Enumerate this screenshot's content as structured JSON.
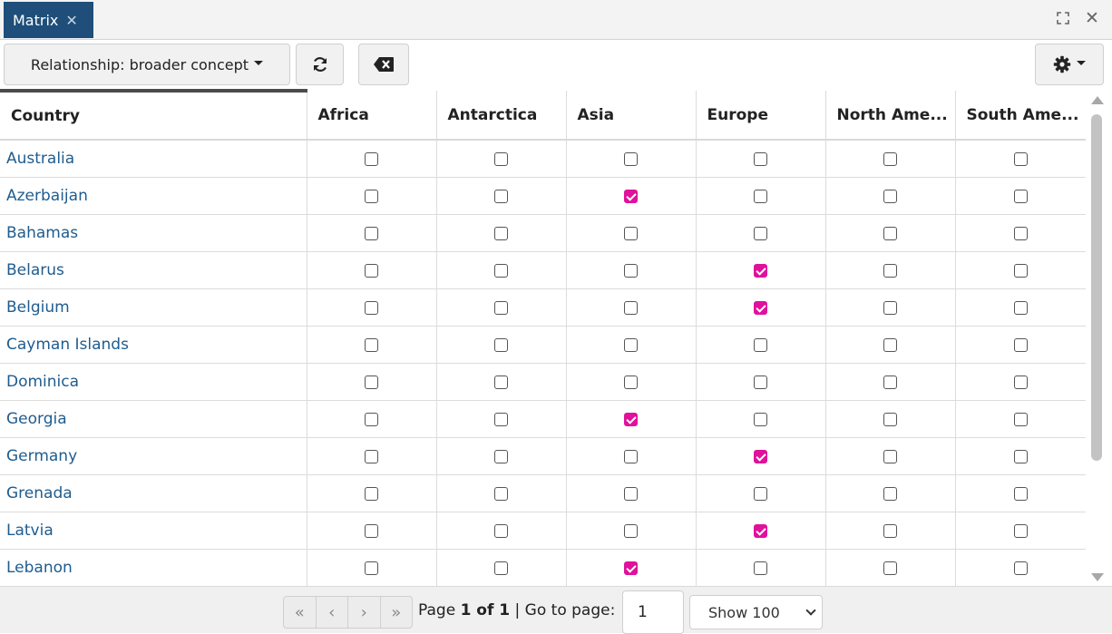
{
  "tab": {
    "title": "Matrix",
    "close_glyph": "✕"
  },
  "window": {
    "expand_icon": "⛶",
    "close_icon": "✕"
  },
  "toolbar": {
    "relationship_label": "Relationship: broader concept",
    "refresh_icon": "↻",
    "clear_icon": "⌫",
    "settings_icon": "⚙"
  },
  "grid": {
    "columns": [
      "Country",
      "Africa",
      "Antarctica",
      "Asia",
      "Europe",
      "North Ame...",
      "South Ame..."
    ],
    "rows": [
      {
        "name": "Australia",
        "checks": [
          false,
          false,
          false,
          false,
          false,
          false
        ]
      },
      {
        "name": "Azerbaijan",
        "checks": [
          false,
          false,
          true,
          false,
          false,
          false
        ]
      },
      {
        "name": "Bahamas",
        "checks": [
          false,
          false,
          false,
          false,
          false,
          false
        ]
      },
      {
        "name": "Belarus",
        "checks": [
          false,
          false,
          false,
          true,
          false,
          false
        ]
      },
      {
        "name": "Belgium",
        "checks": [
          false,
          false,
          false,
          true,
          false,
          false
        ]
      },
      {
        "name": "Cayman Islands",
        "checks": [
          false,
          false,
          false,
          false,
          false,
          false
        ]
      },
      {
        "name": "Dominica",
        "checks": [
          false,
          false,
          false,
          false,
          false,
          false
        ]
      },
      {
        "name": "Georgia",
        "checks": [
          false,
          false,
          true,
          false,
          false,
          false
        ]
      },
      {
        "name": "Germany",
        "checks": [
          false,
          false,
          false,
          true,
          false,
          false
        ]
      },
      {
        "name": "Grenada",
        "checks": [
          false,
          false,
          false,
          false,
          false,
          false
        ]
      },
      {
        "name": "Latvia",
        "checks": [
          false,
          false,
          false,
          true,
          false,
          false
        ]
      },
      {
        "name": "Lebanon",
        "checks": [
          false,
          false,
          true,
          false,
          false,
          false
        ]
      }
    ]
  },
  "footer": {
    "first_icon": "«",
    "prev_icon": "‹",
    "next_icon": "›",
    "last_icon": "»",
    "page_word": "Page",
    "page_current": "1 of 1",
    "goto_label": "| Go to page:",
    "goto_value": "1",
    "show_label": "Show 100"
  },
  "colors": {
    "tab_bg": "#1e4e79",
    "check_on": "#e0119b",
    "link": "#1f5c8e"
  }
}
